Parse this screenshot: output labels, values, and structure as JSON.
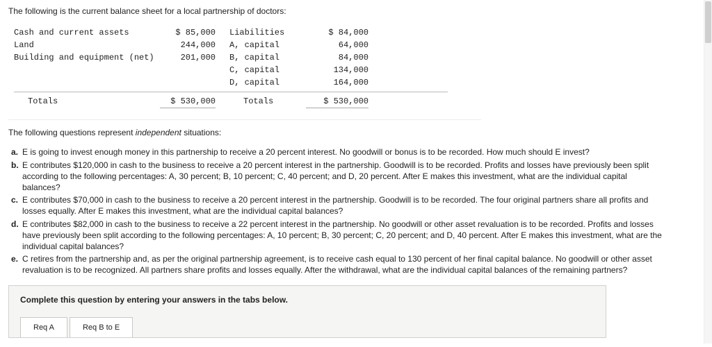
{
  "intro": "The following is the current balance sheet for a local partnership of doctors:",
  "balance_sheet": {
    "left": [
      {
        "label": "Cash and current assets",
        "amount": "$  85,000"
      },
      {
        "label": "Land",
        "amount": "244,000"
      },
      {
        "label": "Building and equipment (net)",
        "amount": "201,000"
      }
    ],
    "right": [
      {
        "label": "Liabilities",
        "amount": "$  84,000"
      },
      {
        "label": "A, capital",
        "amount": "64,000"
      },
      {
        "label": "B, capital",
        "amount": "84,000"
      },
      {
        "label": "C, capital",
        "amount": "134,000"
      },
      {
        "label": "D, capital",
        "amount": "164,000"
      }
    ],
    "totals": {
      "left_label": "Totals",
      "left_amount": "$ 530,000",
      "right_label": "Totals",
      "right_amount": "$ 530,000"
    }
  },
  "independent_line": {
    "prefix": "The following questions represent ",
    "italic": "independent",
    "suffix": " situations:"
  },
  "questions": [
    {
      "letter": "a.",
      "text": "E is going to invest enough money in this partnership to receive a 20 percent interest. No goodwill or bonus is to be recorded. How much should E invest?"
    },
    {
      "letter": "b.",
      "text": "E contributes $120,000 in cash to the business to receive a 20 percent interest in the partnership. Goodwill is to be recorded. Profits and losses have previously been split according to the following percentages: A, 30 percent; B, 10 percent; C, 40 percent; and D, 20 percent. After E makes this investment, what are the individual capital balances?"
    },
    {
      "letter": "c.",
      "text": "E contributes $70,000 in cash to the business to receive a 20 percent interest in the partnership. Goodwill is to be recorded. The four original partners share all profits and losses equally. After E makes this investment, what are the individual capital balances?"
    },
    {
      "letter": "d.",
      "text": "E contributes $82,000 in cash to the business to receive a 22 percent interest in the partnership. No goodwill or other asset revaluation is to be recorded. Profits and losses have previously been split according to the following percentages: A, 10 percent; B, 30 percent; C, 20 percent; and D, 40 percent. After E makes this investment, what are the individual capital balances?"
    },
    {
      "letter": "e.",
      "text": "C retires from the partnership and, as per the original partnership agreement, is to receive cash equal to 130 percent of her final capital balance. No goodwill or other asset revaluation is to be recognized. All partners share profits and losses equally. After the withdrawal, what are the individual capital balances of the remaining partners?"
    }
  ],
  "answer_box": {
    "heading": "Complete this question by entering your answers in the tabs below.",
    "tabs": [
      {
        "label": "Req A"
      },
      {
        "label": "Req B to E"
      }
    ]
  }
}
